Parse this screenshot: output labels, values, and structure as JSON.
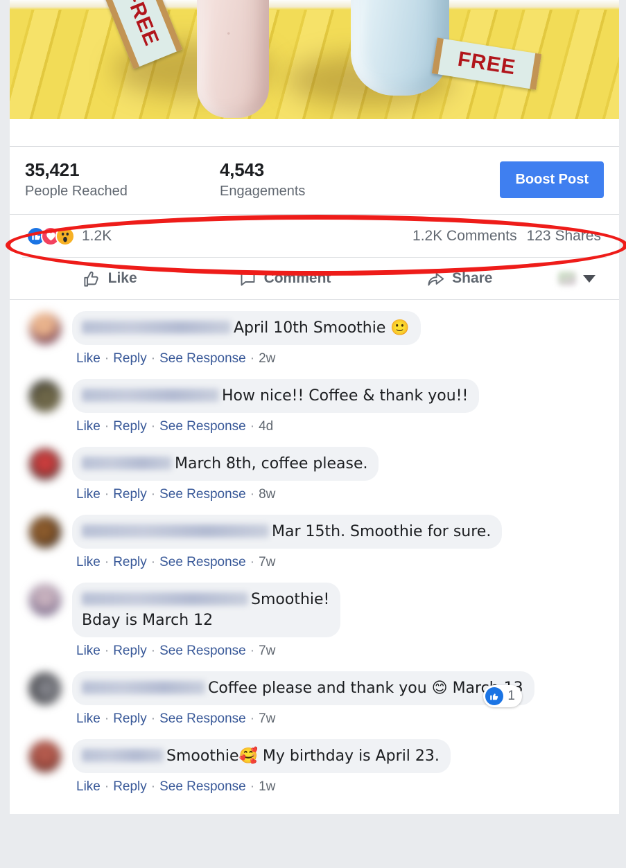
{
  "post": {
    "image": {
      "description": "Two drinks on a yellow wooden deck",
      "tag_left_label": "FREE",
      "tag_right_label": "FREE"
    },
    "insights": {
      "reach_value": "35,421",
      "reach_label": "People Reached",
      "engagements_value": "4,543",
      "engagements_label": "Engagements",
      "boost_label": "Boost Post",
      "boost_color": "#3f7ff0"
    },
    "reactions": {
      "icons": [
        "like-reaction",
        "love-reaction",
        "wow-reaction"
      ],
      "like_glyph": "👍",
      "love_glyph": "♥",
      "wow_glyph": "😮",
      "count": "1.2K",
      "comments_count": "1.2K Comments",
      "shares_count": "123 Shares"
    },
    "actions": {
      "like_label": "Like",
      "comment_label": "Comment",
      "share_label": "Share",
      "audience_caret": "chevron-down-icon"
    }
  },
  "annotation": {
    "type": "ellipse-highlight",
    "color": "#ee1c19",
    "target": "reaction-summary-row"
  },
  "comments": {
    "meta_like": "Like",
    "meta_reply": "Reply",
    "meta_see_response": "See Response",
    "items": [
      {
        "name_redacted": true,
        "name_width": 215,
        "text": "April 10th Smoothie 🙂",
        "time": "2w",
        "avatar_class": "av1",
        "like_count": null
      },
      {
        "name_redacted": true,
        "name_width": 198,
        "text": "How nice!! Coffee & thank you!!",
        "time": "4d",
        "avatar_class": "av2",
        "like_count": null
      },
      {
        "name_redacted": true,
        "name_width": 130,
        "text": "March 8th, coffee please.",
        "time": "8w",
        "avatar_class": "av3",
        "like_count": null
      },
      {
        "name_redacted": true,
        "name_width": 270,
        "text": "Mar 15th. Smoothie for sure.",
        "time": "7w",
        "avatar_class": "av4",
        "like_count": null
      },
      {
        "name_redacted": true,
        "name_width": 240,
        "text": "Smoothie!\nBday is March 12",
        "time": "7w",
        "avatar_class": "av5",
        "like_count": null
      },
      {
        "name_redacted": true,
        "name_width": 178,
        "text": "Coffee please and thank you 😊 March 13",
        "time": "7w",
        "avatar_class": "av6",
        "like_count": "1"
      },
      {
        "name_redacted": true,
        "name_width": 118,
        "text": "Smoothie🥰 My birthday is April 23.",
        "time": "1w",
        "avatar_class": "av7",
        "like_count": null
      }
    ]
  }
}
